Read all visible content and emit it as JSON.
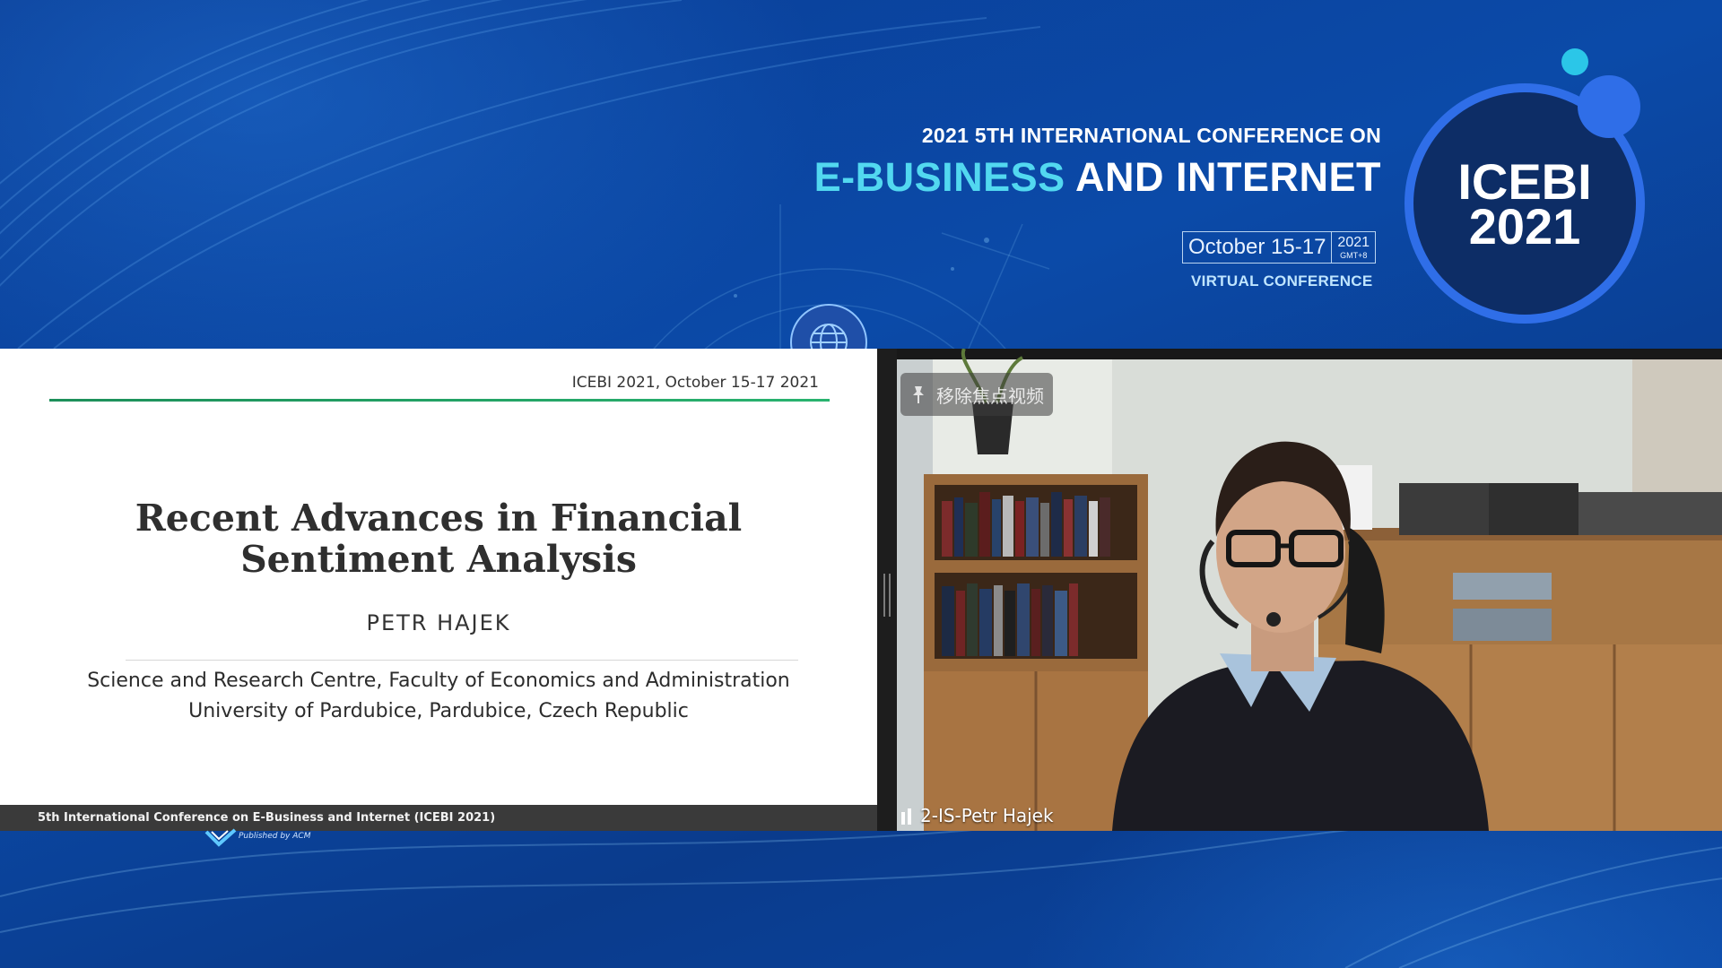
{
  "conference": {
    "line1": "2021 5TH INTERNATIONAL CONFERENCE ON",
    "line2_highlight": "E-BUSINESS",
    "line2_rest": " AND INTERNET",
    "dates": "October 15-17",
    "year": "2021",
    "timezone": "GMT+8",
    "mode": "VIRTUAL CONFERENCE",
    "logo_line1": "ICEBI",
    "logo_line2": "2021"
  },
  "slide": {
    "header": "ICEBI 2021, October 15-17 2021",
    "title_line1": "Recent Advances in Financial",
    "title_line2": "Sentiment Analysis",
    "author": "PETR HAJEK",
    "affiliation_line1": "Science and Research Centre, Faculty of Economics and Administration",
    "affiliation_line2": "University of Pardubice, Pardubice, Czech Republic",
    "footer": "5th International Conference on E-Business and Internet (ICEBI 2021)",
    "publisher_note": "Published by ACM"
  },
  "video": {
    "unpin_label": "移除焦点视频",
    "participant_name": "2-IS-Petr Hajek"
  },
  "colors": {
    "background": "#0b3f93",
    "accent_cyan": "#52d8f0",
    "logo_ring": "#2f6ee8",
    "slide_rule": "#1d8f5a"
  },
  "icons": {
    "globe": "globe-icon",
    "pin": "pin-icon",
    "audio": "audio-bars-icon",
    "acm": "checkmark-icon"
  }
}
